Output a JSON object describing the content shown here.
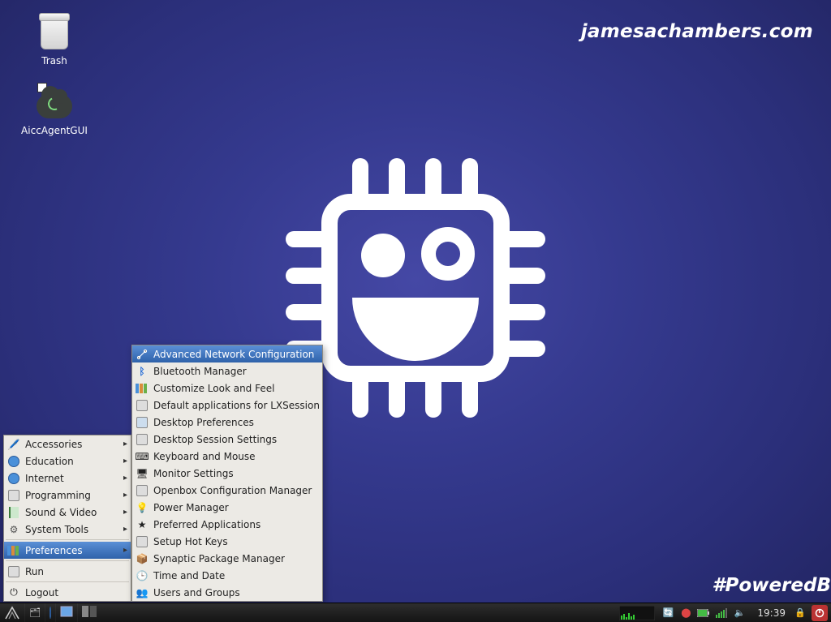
{
  "watermark": {
    "top": "jamesachambers.com",
    "bottom": "#PoweredB"
  },
  "desktop_icons": {
    "trash": "Trash",
    "aicc": "AiccAgentGUI"
  },
  "main_menu": {
    "accessories": "Accessories",
    "education": "Education",
    "internet": "Internet",
    "programming": "Programming",
    "sound_video": "Sound & Video",
    "system_tools": "System Tools",
    "preferences": "Preferences",
    "run": "Run",
    "logout": "Logout"
  },
  "prefs_submenu": {
    "adv_network": "Advanced Network Configuration",
    "bluetooth": "Bluetooth Manager",
    "customize_look": "Customize Look and Feel",
    "default_apps": "Default applications for LXSession",
    "desktop_prefs": "Desktop Preferences",
    "desktop_session": "Desktop Session Settings",
    "keyboard_mouse": "Keyboard and Mouse",
    "monitor": "Monitor Settings",
    "openbox": "Openbox Configuration Manager",
    "power": "Power Manager",
    "preferred_apps": "Preferred Applications",
    "hotkeys": "Setup Hot Keys",
    "synaptic": "Synaptic Package Manager",
    "time_date": "Time and Date",
    "users_groups": "Users and Groups"
  },
  "taskbar": {
    "clock": "19:39"
  }
}
